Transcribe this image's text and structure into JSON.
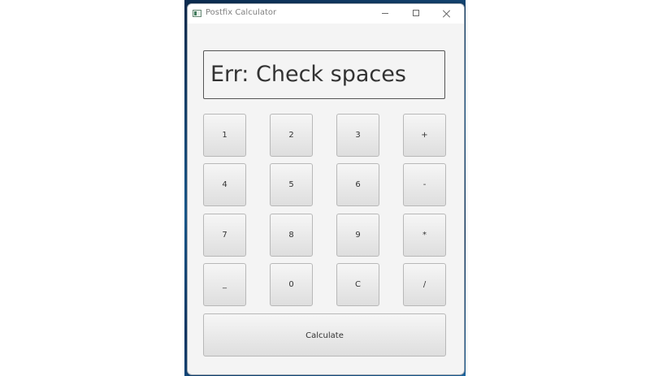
{
  "window": {
    "title": "Postfix Calculator",
    "icon": "app-icon"
  },
  "display": {
    "value": "Err: Check spaces"
  },
  "keys": [
    [
      "1",
      "2",
      "3",
      "+"
    ],
    [
      "4",
      "5",
      "6",
      "-"
    ],
    [
      "7",
      "8",
      "9",
      "*"
    ],
    [
      "_",
      "0",
      "C",
      "/"
    ]
  ],
  "calculate": {
    "label": "Calculate"
  }
}
